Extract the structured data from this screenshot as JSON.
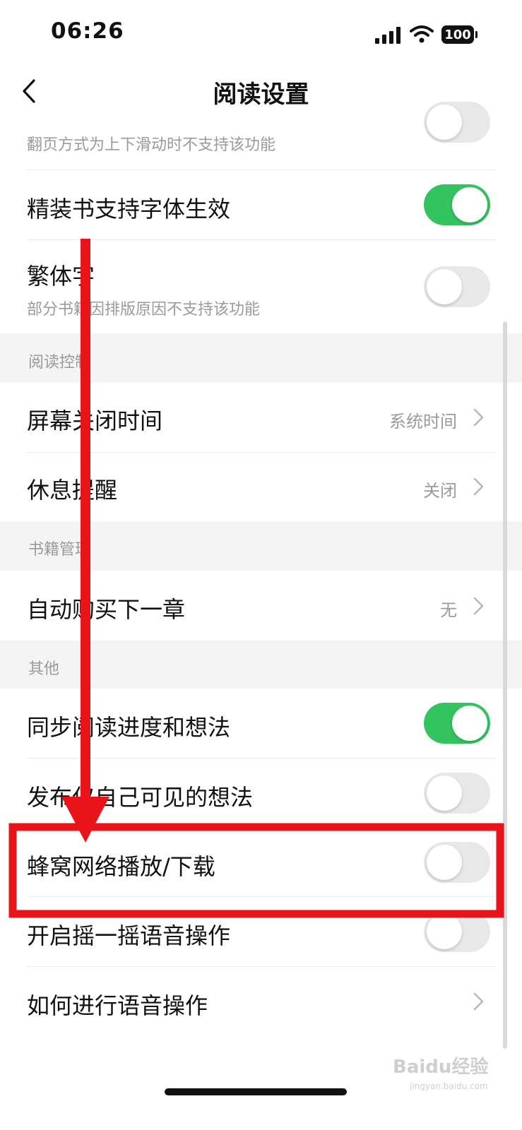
{
  "status_bar": {
    "time": "06:26",
    "battery": "100"
  },
  "nav": {
    "title": "阅读设置",
    "back_icon": "chevron-left-icon"
  },
  "items": {
    "partial_top_sub": "翻页方式为上下滑动时不支持该功能",
    "hardcover_font": "精装书支持字体生效",
    "traditional": "繁体字",
    "traditional_sub": "部分书籍因排版原因不支持该功能",
    "screen_off": "屏幕关闭时间",
    "screen_off_value": "系统时间",
    "rest_reminder": "休息提醒",
    "rest_reminder_value": "关闭",
    "auto_buy": "自动购买下一章",
    "auto_buy_value": "无",
    "sync_progress": "同步阅读进度和想法",
    "self_visible": "发布仅自己可见的想法",
    "cellular": "蜂窝网络播放/下载",
    "shake_voice": "开启摇一摇语音操作",
    "voice_howto": "如何进行语音操作"
  },
  "sections": {
    "reading_control": "阅读控制",
    "book_management": "书籍管理",
    "other": "其他"
  },
  "toggles": {
    "partial_top": false,
    "hardcover_font": true,
    "traditional": false,
    "sync_progress": true,
    "self_visible": false,
    "cellular": false,
    "shake_voice": false
  },
  "watermark": {
    "text": "Baidu经验",
    "sub": "jingyan.baidu.com"
  },
  "colors": {
    "toggle_on": "#33c35f",
    "annotation_red": "#e8141a"
  }
}
